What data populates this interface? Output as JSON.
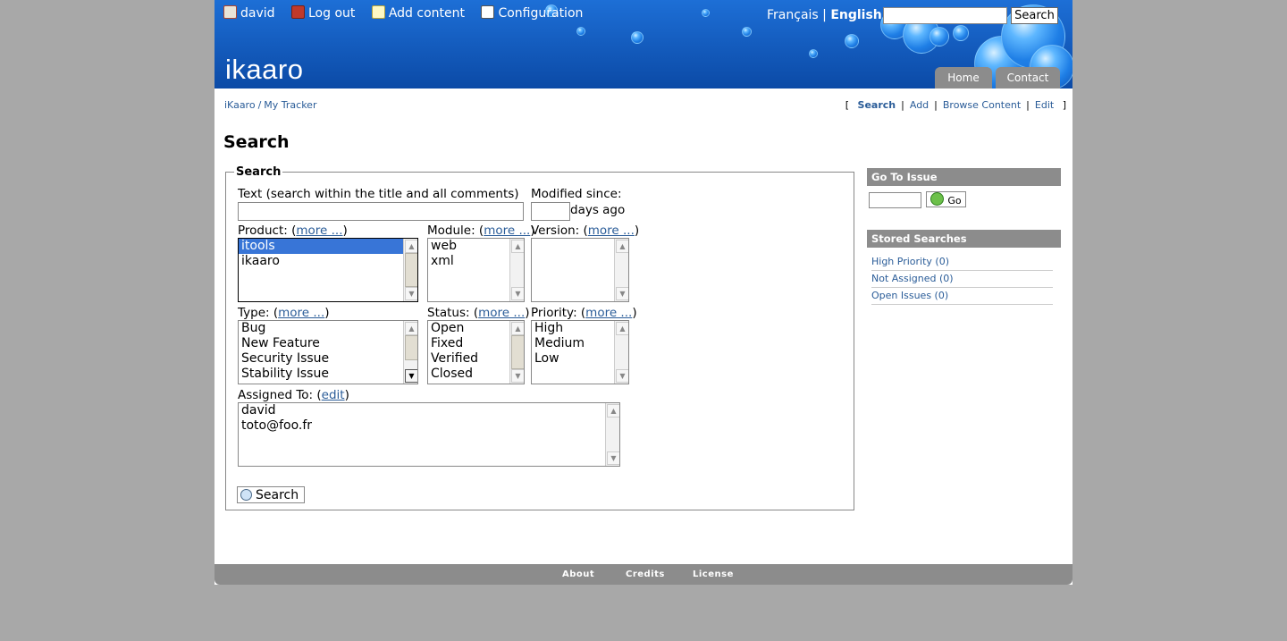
{
  "header": {
    "user": "david",
    "logout": "Log out",
    "add_content": "Add content",
    "configuration": "Configuration",
    "lang_fr": "Français",
    "lang_sep": "|",
    "lang_en": "English",
    "search_button": "Search",
    "logo": "ikaaro",
    "tabs": [
      "Home",
      "Contact"
    ]
  },
  "breadcrumb": {
    "root": "iKaaro",
    "sep": "/",
    "current": "My Tracker"
  },
  "actions": {
    "open": "[",
    "close": "]",
    "sep": "|",
    "items": [
      "Search",
      "Add",
      "Browse Content",
      "Edit"
    ]
  },
  "page_title": "Search",
  "form": {
    "legend": "Search",
    "text_label": "Text (search within the title and all comments)",
    "modified_label": "Modified since:",
    "days_ago": "days ago",
    "product_label": "Product: (",
    "module_label": "Module: (",
    "version_label": "Version: (",
    "type_label": "Type: (",
    "status_label": "Status: (",
    "priority_label": "Priority: (",
    "assigned_label": "Assigned To: (",
    "more": "more ...",
    "edit": "edit",
    "close_paren": ")",
    "products": [
      "itools",
      "ikaaro"
    ],
    "modules": [
      "web",
      "xml"
    ],
    "types": [
      "Bug",
      "New Feature",
      "Security Issue",
      "Stability Issue"
    ],
    "statuses": [
      "Open",
      "Fixed",
      "Verified",
      "Closed"
    ],
    "priorities": [
      "High",
      "Medium",
      "Low"
    ],
    "assignees": [
      "david",
      "toto@foo.fr"
    ],
    "submit": "Search"
  },
  "sidebar": {
    "goto_title": "Go To Issue",
    "go_button": "Go",
    "stored_title": "Stored Searches",
    "stored": [
      "High Priority (0)",
      "Not Assigned (0)",
      "Open Issues (0)"
    ]
  },
  "footer": {
    "links": [
      "About",
      "Credits",
      "License"
    ]
  },
  "colors": {
    "header_blue": "#1660c3",
    "link": "#2a5c98",
    "tab_gray": "#8c8c8c",
    "selection": "#3875d7"
  }
}
